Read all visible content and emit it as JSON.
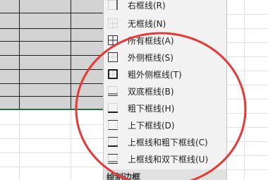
{
  "menu": {
    "items": [
      {
        "label": "右框线(R)",
        "icon": "right-border-icon"
      },
      {
        "label": "无框线(N)",
        "icon": "no-border-icon"
      },
      {
        "label": "所有框线(A)",
        "icon": "all-borders-icon"
      },
      {
        "label": "外侧框线(S)",
        "icon": "outside-borders-icon"
      },
      {
        "label": "粗外侧框线(T)",
        "icon": "thick-outside-borders-icon"
      },
      {
        "label": "双底框线(B)",
        "icon": "double-bottom-border-icon"
      },
      {
        "label": "粗下框线(H)",
        "icon": "thick-bottom-border-icon"
      },
      {
        "label": "上下框线(D)",
        "icon": "top-bottom-border-icon"
      },
      {
        "label": "上框线和粗下框线(C)",
        "icon": "top-thick-bottom-border-icon"
      },
      {
        "label": "上框线和双下框线(U)",
        "icon": "top-double-bottom-border-icon"
      }
    ],
    "section_header": "绘制边框"
  },
  "colors": {
    "annotation": "#e53935",
    "selection": "#d3d3d3",
    "menu_bg": "#f2f2f2",
    "excel_green": "#217346"
  }
}
